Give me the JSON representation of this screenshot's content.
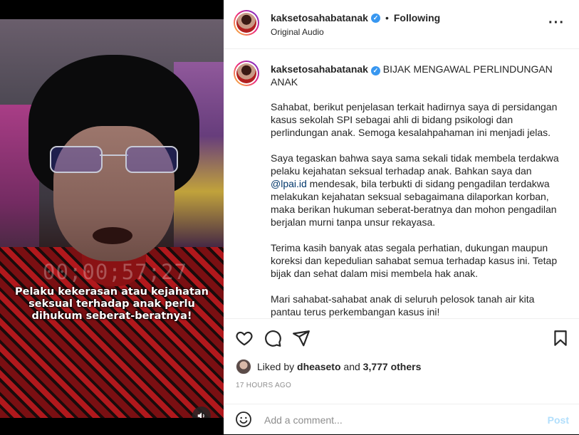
{
  "media": {
    "timecode": "00;00;57;27",
    "caption_text": "Pelaku kekerasan atau kejahatan seksual terhadap anak perlu dihukum seberat-beratnya!",
    "mute_icon": "speaker-icon"
  },
  "header": {
    "username": "kaksetosahabatanak",
    "verified_icon": "verified-badge-icon",
    "separator": "•",
    "follow_status": "Following",
    "audio_label": "Original Audio",
    "more_icon": "more-options-icon"
  },
  "caption": {
    "username": "kaksetosahabatanak",
    "title": "BIJAK MENGAWAL PERLINDUNGAN ANAK",
    "p1": "Sahabat, berikut penjelasan terkait hadirnya saya di persidangan kasus sekolah SPI sebagai ahli di bidang psikologi dan perlindungan anak. Semoga kesalahpahaman ini menjadi jelas.",
    "p2_before": "Saya tegaskan bahwa saya sama sekali tidak membela terdakwa pelaku kejahatan seksual terhadap anak. Bahkan saya dan ",
    "p2_mention": "@lpai.id",
    "p2_after": " mendesak, bila terbukti di sidang pengadilan terdakwa melakukan kejahatan seksual sebagaimana dilaporkan korban, maka berikan hukuman seberat-beratnya dan mohon pengadilan berjalan murni tanpa unsur rekayasa.",
    "p3": "Terima kasih banyak atas segala perhatian, dukungan maupun koreksi dan kepedulian sahabat semua terhadap kasus ini. Tetap bijak dan sehat dalam misi membela hak anak.",
    "p4": "Mari sahabat-sahabat anak di seluruh pelosok tanah air kita pantau terus perkembangan kasus ini!"
  },
  "actions": {
    "like_icon": "heart-icon",
    "comment_icon": "comment-icon",
    "share_icon": "share-icon",
    "save_icon": "bookmark-icon",
    "liked_by_prefix": "Liked by",
    "liked_by_user": "dheaseto",
    "and": "and",
    "others": "3,777 others",
    "timestamp": "17 HOURS AGO"
  },
  "comment_box": {
    "emoji_icon": "emoji-icon",
    "placeholder": "Add a comment...",
    "post_label": "Post"
  },
  "colors": {
    "link": "#00376b",
    "verified": "#3897f0",
    "post_disabled": "#b2dffc",
    "muted_text": "#8e8e8e"
  }
}
